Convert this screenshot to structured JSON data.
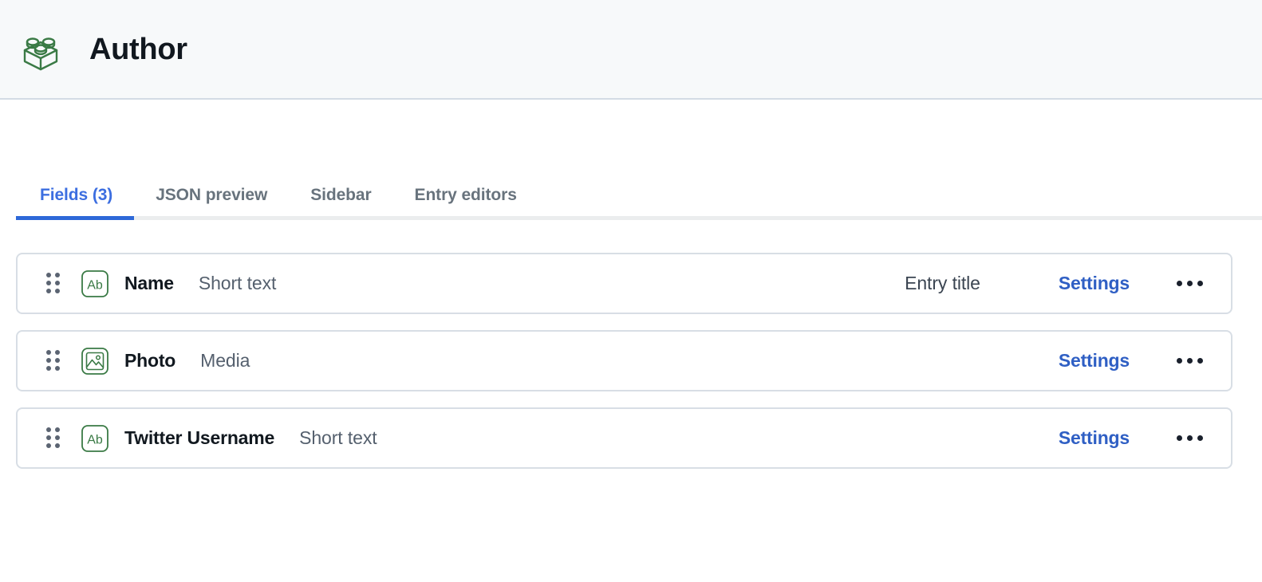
{
  "header": {
    "icon": "lego-brick-icon",
    "title": "Author",
    "icon_color": "#3a7a45",
    "background": "#f7f9fa",
    "border_color": "#d3dce5"
  },
  "tabs": {
    "active_index": 0,
    "active_color": "#2d68d8",
    "inactive_color": "#68737d",
    "items": [
      {
        "label": "Fields (3)",
        "name": "tab-fields"
      },
      {
        "label": "JSON preview",
        "name": "tab-json-preview"
      },
      {
        "label": "Sidebar",
        "name": "tab-sidebar"
      },
      {
        "label": "Entry editors",
        "name": "tab-entry-editors"
      }
    ]
  },
  "fields": {
    "settings_label": "Settings",
    "settings_color": "#2f5fc4",
    "menu_icon": "kebab-menu-icon",
    "drag_icon": "drag-handle-icon",
    "rows": [
      {
        "name": "Name",
        "type": "Short text",
        "type_icon": "short-text-icon",
        "badge": "Entry title"
      },
      {
        "name": "Photo",
        "type": "Media",
        "type_icon": "media-image-icon",
        "badge": ""
      },
      {
        "name": "Twitter Username",
        "type": "Short text",
        "type_icon": "short-text-icon",
        "badge": ""
      }
    ]
  }
}
